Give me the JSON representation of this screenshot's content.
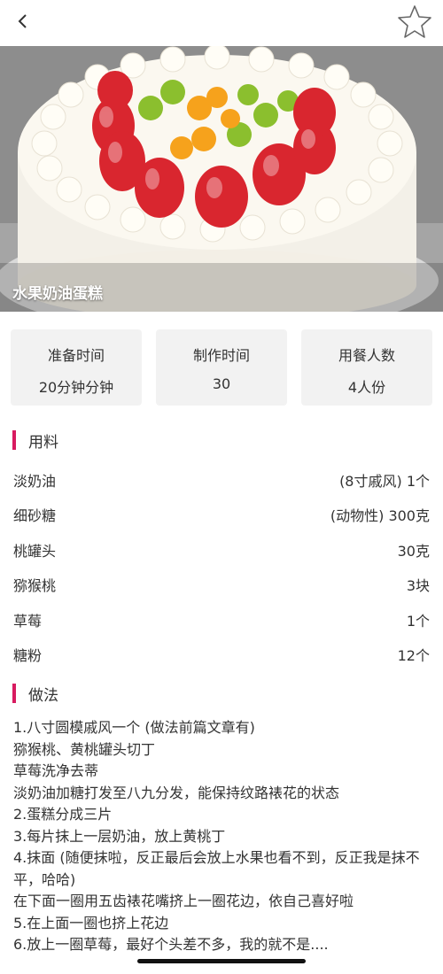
{
  "header": {
    "back_icon": "chevron-left-icon",
    "favorite_icon": "star-outline-icon"
  },
  "recipe": {
    "title": "水果奶油蛋糕",
    "image": "fruit-cream-cake-photo"
  },
  "stats": [
    {
      "label": "准备时间",
      "value": "20分钟分钟"
    },
    {
      "label": "制作时间",
      "value": "30"
    },
    {
      "label": "用餐人数",
      "value": "4人份"
    }
  ],
  "ingredients_section": {
    "title": "用料",
    "accent": "#d81b60"
  },
  "ingredients": [
    {
      "name": "淡奶油",
      "amount": "(8寸戚风) 1个"
    },
    {
      "name": "细砂糖",
      "amount": "(动物性) 300克"
    },
    {
      "name": "桃罐头",
      "amount": "30克"
    },
    {
      "name": "猕猴桃",
      "amount": "3块"
    },
    {
      "name": "草莓",
      "amount": "1个"
    },
    {
      "name": "糖粉",
      "amount": "12个"
    }
  ],
  "steps_section": {
    "title": "做法"
  },
  "steps": [
    "1.八寸圆模戚风一个 (做法前篇文章有)",
    "猕猴桃、黄桃罐头切丁",
    "草莓洗净去蒂",
    "淡奶油加糖打发至八九分发，能保持纹路裱花的状态",
    "2.蛋糕分成三片",
    "3.每片抹上一层奶油，放上黄桃丁",
    "4.抹面 (随便抹啦，反正最后会放上水果也看不到，反正我是抹不平，哈哈)",
    "在下面一圈用五齿裱花嘴挤上一圈花边，依自己喜好啦",
    "5.在上面一圈也挤上花边",
    "6.放上一圈草莓，最好个头差不多，我的就不是...."
  ]
}
